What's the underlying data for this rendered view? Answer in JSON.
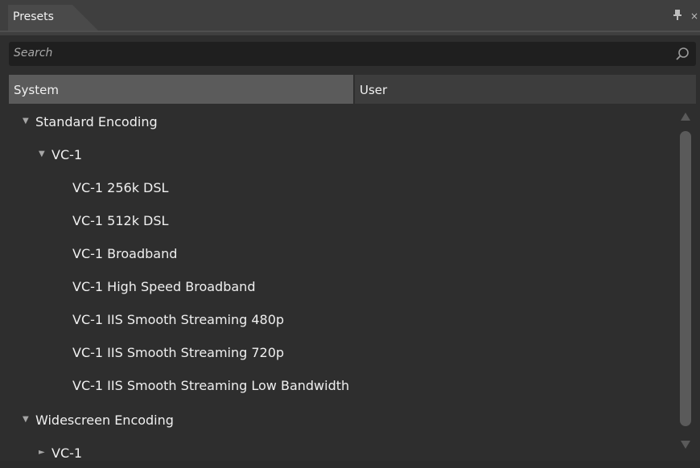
{
  "panel": {
    "title": "Presets",
    "close_glyph": "×"
  },
  "search": {
    "placeholder": "Search"
  },
  "tabs": [
    {
      "label": "System",
      "selected": true
    },
    {
      "label": "User",
      "selected": false
    }
  ],
  "tree": {
    "items": [
      {
        "label": "Standard Encoding",
        "expanded": true,
        "arrow": "▼"
      },
      {
        "label": "VC-1",
        "expanded": true,
        "arrow": "▼"
      },
      {
        "label": "VC-1 256k DSL"
      },
      {
        "label": "VC-1 512k DSL"
      },
      {
        "label": "VC-1 Broadband"
      },
      {
        "label": "VC-1 High Speed Broadband"
      },
      {
        "label": "VC-1 IIS Smooth Streaming 480p"
      },
      {
        "label": "VC-1 IIS Smooth Streaming 720p"
      },
      {
        "label": "VC-1 IIS Smooth Streaming Low Bandwidth"
      },
      {
        "label": "Widescreen Encoding",
        "expanded": true,
        "arrow": "▼"
      },
      {
        "label": "VC-1",
        "expanded": false,
        "arrow": "►"
      }
    ]
  },
  "colors": {
    "panel_bg": "#2e2e2e",
    "selected_tab": "#5b5b5b",
    "text": "#f0f0f0"
  }
}
